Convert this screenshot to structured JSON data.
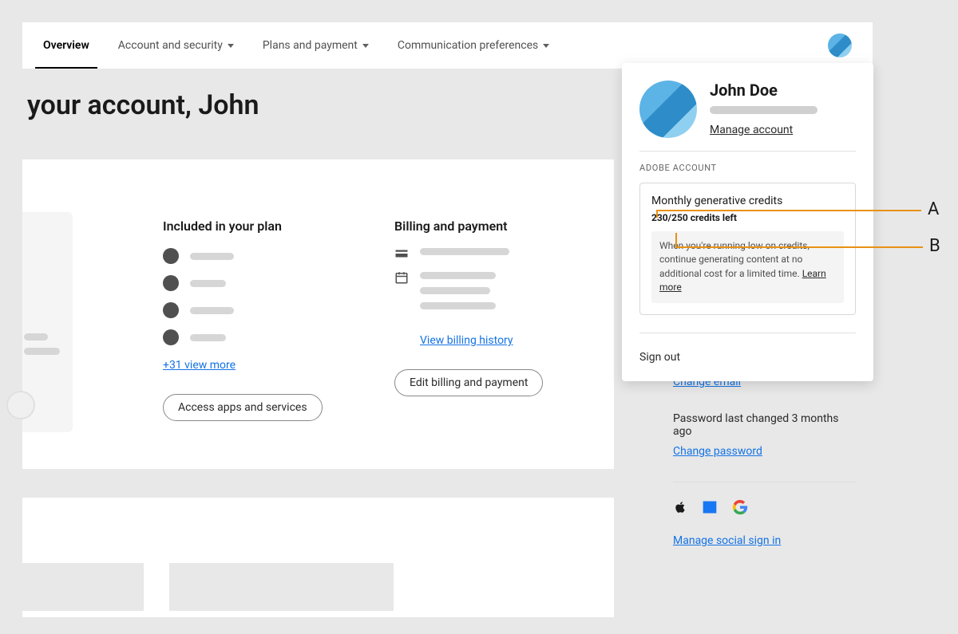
{
  "nav": {
    "items": [
      {
        "label": "Overview"
      },
      {
        "label": "Account and security"
      },
      {
        "label": "Plans and payment"
      },
      {
        "label": "Communication preferences"
      }
    ]
  },
  "page": {
    "title": "your account, John"
  },
  "plan": {
    "title": "Included in your plan",
    "view_more": "+31 view more",
    "access_btn": "Access apps and services"
  },
  "billing": {
    "title": "Billing and payment",
    "view_history": "View billing history",
    "edit_btn": "Edit billing and payment"
  },
  "right": {
    "change_email": "Change email",
    "password_text": "Password last changed 3 months ago",
    "change_password": "Change password",
    "manage_social": "Manage social sign in"
  },
  "popover": {
    "name": "John Doe",
    "manage": "Manage account",
    "section": "ADOBE ACCOUNT",
    "credits_title": "Monthly generative credits",
    "credits_count": "230/250 credits left",
    "credits_info": "When you're running low on credits, continue generating content at no additional cost for a limited time. ",
    "learn_more": "Learn more",
    "sign_out": "Sign out"
  },
  "callouts": {
    "a": "A",
    "b": "B"
  }
}
